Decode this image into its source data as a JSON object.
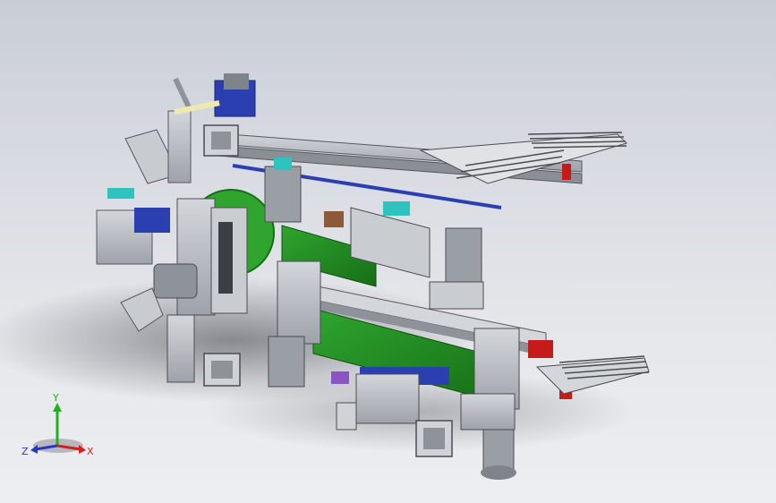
{
  "viewport": {
    "background_top": "#c9cdd6",
    "background_bottom": "#eceef1"
  },
  "model": {
    "colors": {
      "frame": "#b9bcc2",
      "frame_dark": "#6e7177",
      "plate_green": "#1f8a1f",
      "accent_red": "#c51b1b",
      "accent_blue": "#2b3fb0",
      "accent_cyan": "#2fc3c0",
      "accent_brown": "#8a5a3a",
      "accent_purple": "#8a55c0",
      "motor_grey": "#9a9ea5"
    }
  },
  "triad": {
    "x_label": "X",
    "y_label": "Y",
    "z_label": "Z",
    "x_color": "#d32020",
    "y_color": "#1fb11f",
    "z_color": "#2b35c8"
  }
}
